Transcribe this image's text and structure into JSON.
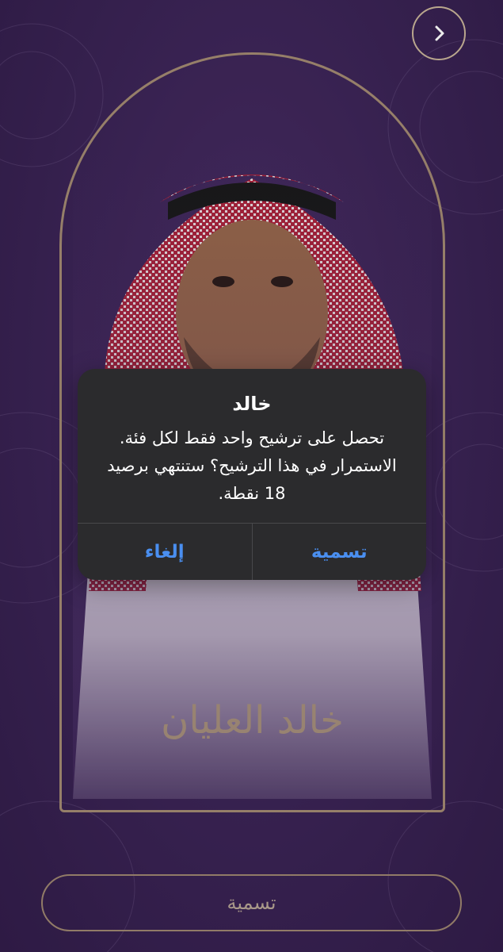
{
  "screen": {
    "back_icon": "chevron-right-icon",
    "nominee_name": "خالد العليان",
    "name_button_label": "تسمية"
  },
  "alert": {
    "title": "خالد",
    "message": "تحصل على ترشيح واحد فقط لكل فئة. الاستمرار في هذا الترشيح؟ ستنتهي برصيد 18 نقطة.",
    "cancel_label": "إلغاء",
    "confirm_label": "تسمية"
  },
  "colors": {
    "background": "#3d2558",
    "gold_border": "#a38a72",
    "alert_bg": "#2b2b2d",
    "alert_action": "#4a8ff0"
  }
}
